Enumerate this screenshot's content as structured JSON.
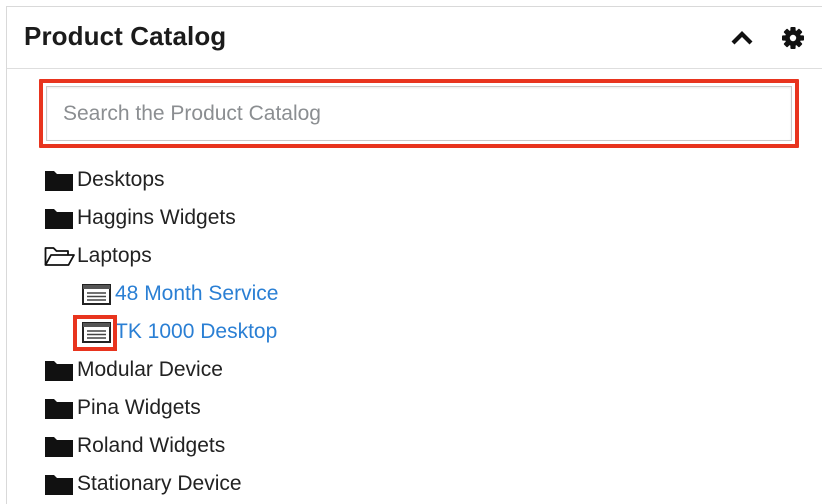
{
  "header": {
    "title": "Product Catalog",
    "collapse_icon": "chevron-up-icon",
    "settings_icon": "gear-icon"
  },
  "search": {
    "placeholder": "Search the Product Catalog",
    "value": ""
  },
  "tree": {
    "items": [
      {
        "label": "Desktops",
        "type": "folder",
        "icon": "folder-closed-icon"
      },
      {
        "label": "Haggins Widgets",
        "type": "folder",
        "icon": "folder-closed-icon"
      },
      {
        "label": "Laptops",
        "type": "folder-open",
        "icon": "folder-open-icon"
      },
      {
        "label": "48 Month Service",
        "type": "product",
        "icon": "product-list-icon"
      },
      {
        "label": "TK 1000 Desktop",
        "type": "product",
        "icon": "product-list-icon"
      },
      {
        "label": "Modular Device",
        "type": "folder",
        "icon": "folder-closed-icon"
      },
      {
        "label": "Pina Widgets",
        "type": "folder",
        "icon": "folder-closed-icon"
      },
      {
        "label": "Roland Widgets",
        "type": "folder",
        "icon": "folder-closed-icon"
      },
      {
        "label": "Stationary Device",
        "type": "folder",
        "icon": "folder-closed-icon"
      }
    ]
  },
  "colors": {
    "highlight": "#e8341e",
    "link": "#2a7fd4",
    "text": "#222222"
  }
}
